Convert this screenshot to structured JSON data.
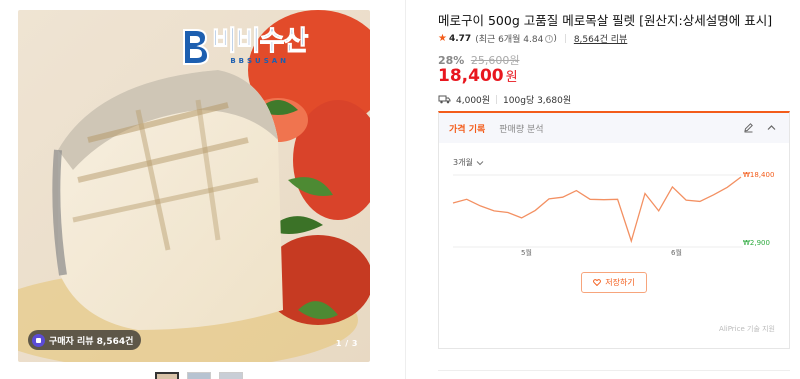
{
  "image": {
    "logo_text": "비비수산",
    "logo_sub": "BBSUSAN",
    "review_chip": "구매자 리뷰 8,564건",
    "counter": "1 / 3"
  },
  "product": {
    "title": "메로구이 500g 고품질 메로목살 필렛 [원산지:상세설명에 표시]",
    "rating": "4.77",
    "recent_rating": "(최근 6개월 4.84",
    "recent_close": ")",
    "review_count": "8,564건 리뷰",
    "discount": "28%",
    "original_price": "25,600원",
    "price": "18,400",
    "price_unit": "원",
    "shipping": "4,000원",
    "unit_price": "100g당 3,680원"
  },
  "price_panel": {
    "tab_history": "가격 기록",
    "tab_sales": "판매량 분석",
    "period": "3개월",
    "max_label": "₩18,400",
    "min_label": "₩2,900",
    "save_button": "저장하기",
    "credit": "AliPrice 기술 지원"
  },
  "chart_data": {
    "type": "line",
    "x_ticks": [
      "5월",
      "6월"
    ],
    "max_price": 18400,
    "min_price": 2900,
    "series": [
      {
        "values": [
          12100,
          13000,
          11400,
          10200,
          9800,
          8500,
          10300,
          13100,
          13500,
          15100,
          13000,
          12900,
          13000,
          2900,
          14400,
          10200,
          16000,
          12800,
          12500,
          14100,
          15900,
          18400
        ]
      }
    ]
  },
  "colors": {
    "accent": "#f35c1a",
    "price_red": "#e8171f",
    "max_label": "#f35c1a",
    "min_label": "#2eaa3f"
  }
}
